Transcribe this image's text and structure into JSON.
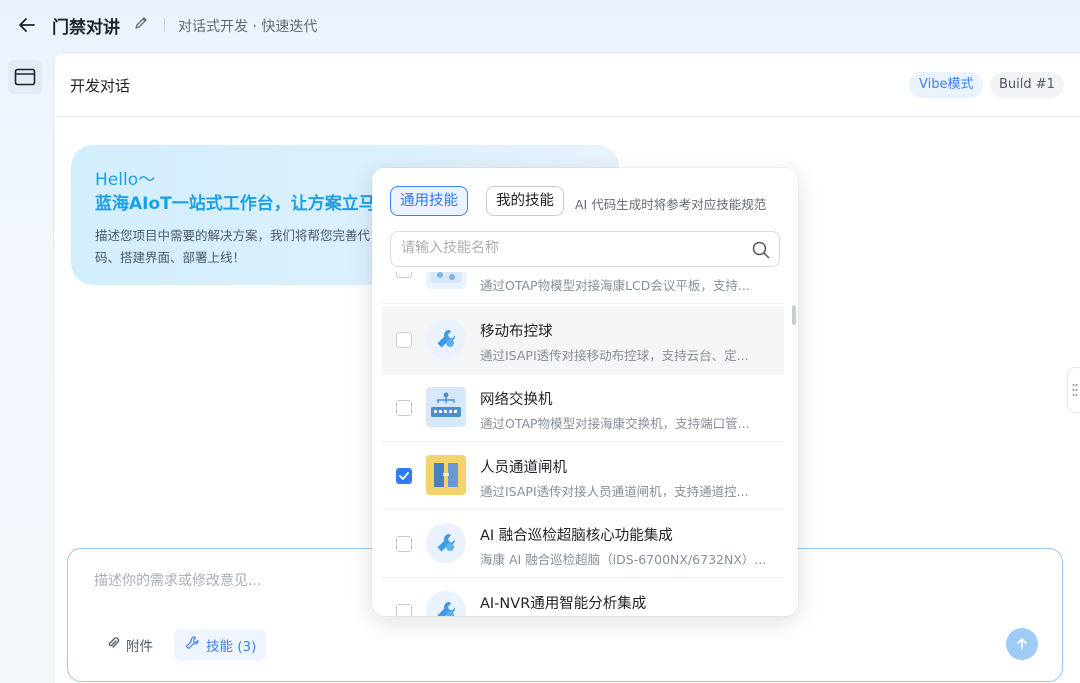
{
  "topbar": {
    "title": "门禁对讲",
    "subtitle": "对话式开发 · 快速迭代"
  },
  "panel": {
    "title": "开发对话",
    "mode_badge": "Vibe模式",
    "build_badge": "Build #1"
  },
  "hello": {
    "greeting": "Hello～",
    "headline": "蓝海AIoT一站式工作台，让方案立马",
    "description": "描述您项目中需要的解决方案，我们将帮您完善代码、搭建界面、部署上线！"
  },
  "composer": {
    "placeholder": "描述你的需求或修改意见...",
    "attach_label": "附件",
    "skill_label": "技能 (3)"
  },
  "skills_dropdown": {
    "tab_general": "通用技能",
    "tab_mine": "我的技能",
    "hint": "AI 代码生成时将参考对应技能规范",
    "search_placeholder": "请输入技能名称",
    "items": [
      {
        "title": "",
        "desc": "通过OTAP物模型对接海康LCD会议平板，支持...",
        "checked": false,
        "icon": "device-icon"
      },
      {
        "title": "移动布控球",
        "desc": "通过ISAPI透传对接移动布控球，支持云台、定...",
        "checked": false,
        "icon": "wrench-icon"
      },
      {
        "title": "网络交换机",
        "desc": "通过OTAP物模型对接海康交换机，支持端口管...",
        "checked": false,
        "icon": "switch-icon"
      },
      {
        "title": "人员通道闸机",
        "desc": "通过ISAPI透传对接人员通道闸机，支持通道控...",
        "checked": true,
        "icon": "gate-icon"
      },
      {
        "title": "AI 融合巡检超脑核心功能集成",
        "desc": "海康 AI 融合巡检超脑（iDS-6700NX/6732NX）...",
        "checked": false,
        "icon": "wrench-icon"
      },
      {
        "title": "AI-NVR通用智能分析集成",
        "desc": "",
        "checked": false,
        "icon": "wrench-icon"
      }
    ]
  },
  "colors": {
    "accent": "#2f7cf6",
    "hello_text": "#1aa0e8",
    "send_button": "#9fcbf6"
  }
}
